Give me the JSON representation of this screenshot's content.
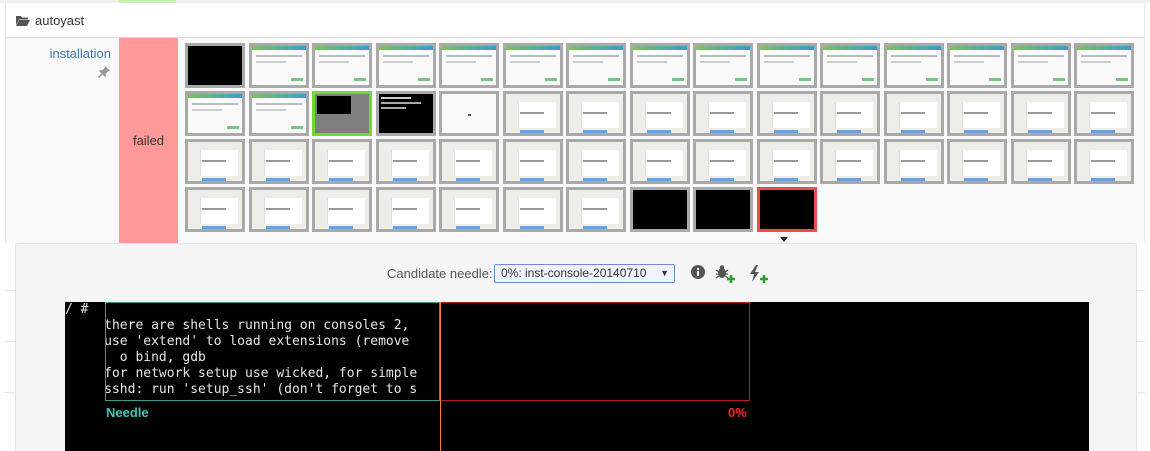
{
  "section": {
    "title": "autoyast",
    "icon": "folder-open-icon"
  },
  "module": {
    "name": "installation",
    "flag_icon": "pin-icon",
    "result": "failed",
    "result_color": "#ff9999"
  },
  "thumbnail_kinds": [
    "black",
    "installer",
    "installer",
    "installer",
    "installer",
    "installer",
    "installer",
    "installer",
    "installer",
    "installer",
    "installer",
    "installer",
    "installer",
    "installer",
    "installer",
    "installer",
    "installer",
    "gray-selected",
    "black-text",
    "white",
    "console",
    "console",
    "console",
    "console",
    "console",
    "console",
    "console",
    "console",
    "console",
    "console",
    "console",
    "console",
    "console",
    "console",
    "console",
    "console",
    "console",
    "console",
    "console",
    "console",
    "console",
    "console",
    "console",
    "console",
    "console",
    "console",
    "console",
    "console",
    "console",
    "console",
    "console",
    "console",
    "black",
    "black",
    "black-failed"
  ],
  "candidate": {
    "label": "Candidate needle:",
    "selected": "0%: inst-console-20140710"
  },
  "icons": {
    "info": "info-icon",
    "bug": "bug-add-icon",
    "flash": "flash-add-icon"
  },
  "console_text": "/ #\n     there are shells running on consoles 2,\n     use 'extend' to load extensions (remove\n       o bind, gdb\n     for network setup use wicked, for simple\n     sshd: run 'setup_ssh' (don't forget to s",
  "needle_label": "Needle",
  "match_label": "0%",
  "colors": {
    "needle": "#3ec7b8",
    "match": "#ff2222",
    "selected_green": "#6fdb30",
    "failed_red": "#e94d4d"
  }
}
